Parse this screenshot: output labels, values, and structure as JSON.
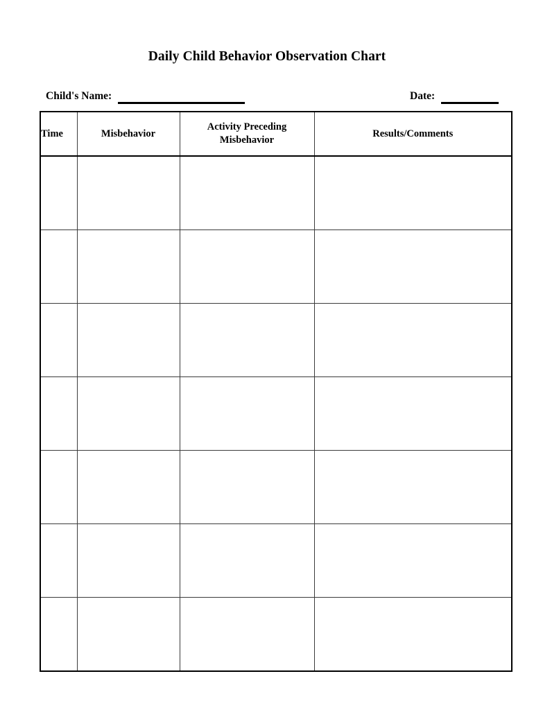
{
  "document": {
    "title": "Daily Child Behavior Observation Chart"
  },
  "fields": {
    "child_name": {
      "label": "Child's Name:",
      "value": ""
    },
    "date": {
      "label": "Date:",
      "value": ""
    }
  },
  "table": {
    "columns": [
      {
        "key": "time",
        "label": "Time"
      },
      {
        "key": "behavior",
        "label": "Misbehavior"
      },
      {
        "key": "activity",
        "label_line1": "Activity Preceding",
        "label_line2": "Misbehavior"
      },
      {
        "key": "results",
        "label": "Results/Comments"
      }
    ],
    "rows": [
      {
        "time": "",
        "behavior": "",
        "activity": "",
        "results": ""
      },
      {
        "time": "",
        "behavior": "",
        "activity": "",
        "results": ""
      },
      {
        "time": "",
        "behavior": "",
        "activity": "",
        "results": ""
      },
      {
        "time": "",
        "behavior": "",
        "activity": "",
        "results": ""
      },
      {
        "time": "",
        "behavior": "",
        "activity": "",
        "results": ""
      },
      {
        "time": "",
        "behavior": "",
        "activity": "",
        "results": ""
      },
      {
        "time": "",
        "behavior": "",
        "activity": "",
        "results": ""
      }
    ]
  },
  "style": {
    "page_background": "#ffffff",
    "ink": "#000000",
    "grid_line": "#3a3a3a"
  }
}
